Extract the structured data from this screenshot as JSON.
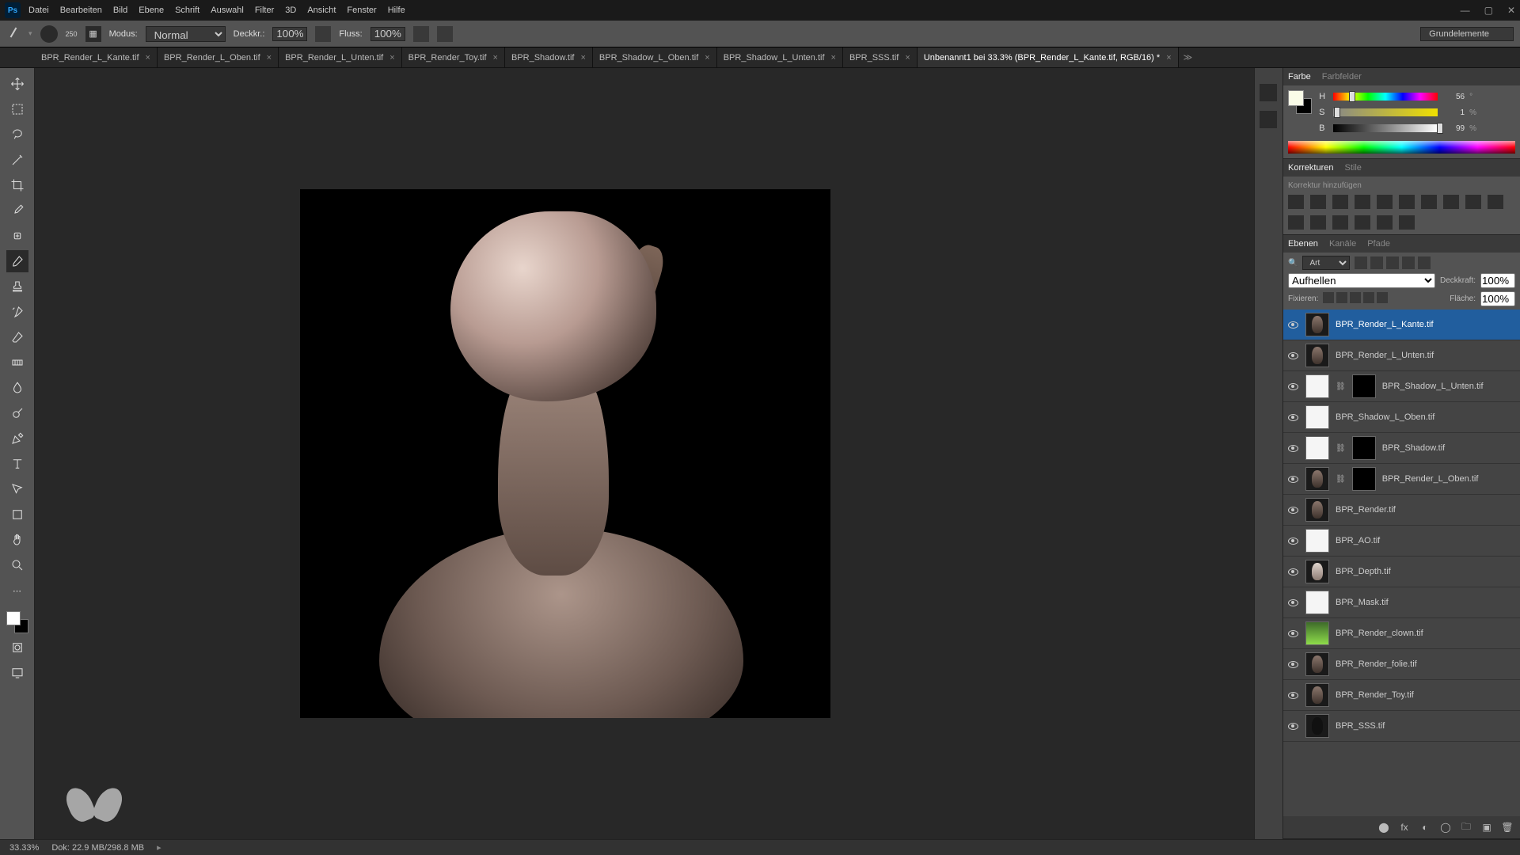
{
  "menu": [
    "Datei",
    "Bearbeiten",
    "Bild",
    "Ebene",
    "Schrift",
    "Auswahl",
    "Filter",
    "3D",
    "Ansicht",
    "Fenster",
    "Hilfe"
  ],
  "options": {
    "brush_size": "250",
    "mode_label": "Modus:",
    "mode_value": "Normal",
    "opacity_label": "Deckkr.:",
    "opacity_value": "100%",
    "flow_label": "Fluss:",
    "flow_value": "100%",
    "workspace": "Grundelemente"
  },
  "tabs": [
    {
      "label": "BPR_Render_L_Kante.tif",
      "active": false
    },
    {
      "label": "BPR_Render_L_Oben.tif",
      "active": false
    },
    {
      "label": "BPR_Render_L_Unten.tif",
      "active": false
    },
    {
      "label": "BPR_Render_Toy.tif",
      "active": false
    },
    {
      "label": "BPR_Shadow.tif",
      "active": false
    },
    {
      "label": "BPR_Shadow_L_Oben.tif",
      "active": false
    },
    {
      "label": "BPR_Shadow_L_Unten.tif",
      "active": false
    },
    {
      "label": "BPR_SSS.tif",
      "active": false
    },
    {
      "label": "Unbenannt1 bei 33.3% (BPR_Render_L_Kante.tif, RGB/16) *",
      "active": true
    }
  ],
  "color_panel": {
    "tab1": "Farbe",
    "tab2": "Farbfelder",
    "h_label": "H",
    "h_val": "56",
    "h_unit": "°",
    "s_label": "S",
    "s_val": "1",
    "s_unit": "%",
    "b_label": "B",
    "b_val": "99",
    "b_unit": "%"
  },
  "adjustments": {
    "tab1": "Korrekturen",
    "tab2": "Stile",
    "hint": "Korrektur hinzufügen"
  },
  "layers_panel": {
    "tab1": "Ebenen",
    "tab2": "Kanäle",
    "tab3": "Pfade",
    "kind_label": "Art",
    "blend_value": "Aufhellen",
    "opacity_label": "Deckkraft:",
    "opacity_value": "100%",
    "lock_label": "Fixieren:",
    "fill_label": "Fläche:",
    "fill_value": "100%"
  },
  "layers": [
    {
      "name": "BPR_Render_L_Kante.tif",
      "selected": true,
      "mask": false,
      "thumb": "dark"
    },
    {
      "name": "BPR_Render_L_Unten.tif",
      "selected": false,
      "mask": false,
      "thumb": "dark"
    },
    {
      "name": "BPR_Shadow_L_Unten.tif",
      "selected": false,
      "mask": true,
      "thumb": "white"
    },
    {
      "name": "BPR_Shadow_L_Oben.tif",
      "selected": false,
      "mask": false,
      "thumb": "white"
    },
    {
      "name": "BPR_Shadow.tif",
      "selected": false,
      "mask": true,
      "thumb": "white"
    },
    {
      "name": "BPR_Render_L_Oben.tif",
      "selected": false,
      "mask": true,
      "thumb": "dark"
    },
    {
      "name": "BPR_Render.tif",
      "selected": false,
      "mask": false,
      "thumb": "dark"
    },
    {
      "name": "BPR_AO.tif",
      "selected": false,
      "mask": false,
      "thumb": "white"
    },
    {
      "name": "BPR_Depth.tif",
      "selected": false,
      "mask": false,
      "thumb": "light"
    },
    {
      "name": "BPR_Mask.tif",
      "selected": false,
      "mask": false,
      "thumb": "white"
    },
    {
      "name": "BPR_Render_clown.tif",
      "selected": false,
      "mask": false,
      "thumb": "green"
    },
    {
      "name": "BPR_Render_folie.tif",
      "selected": false,
      "mask": false,
      "thumb": "dark"
    },
    {
      "name": "BPR_Render_Toy.tif",
      "selected": false,
      "mask": false,
      "thumb": "dark"
    },
    {
      "name": "BPR_SSS.tif",
      "selected": false,
      "mask": false,
      "thumb": "sil"
    }
  ],
  "status": {
    "zoom": "33.33%",
    "doc": "Dok: 22.9 MB/298.8 MB"
  }
}
